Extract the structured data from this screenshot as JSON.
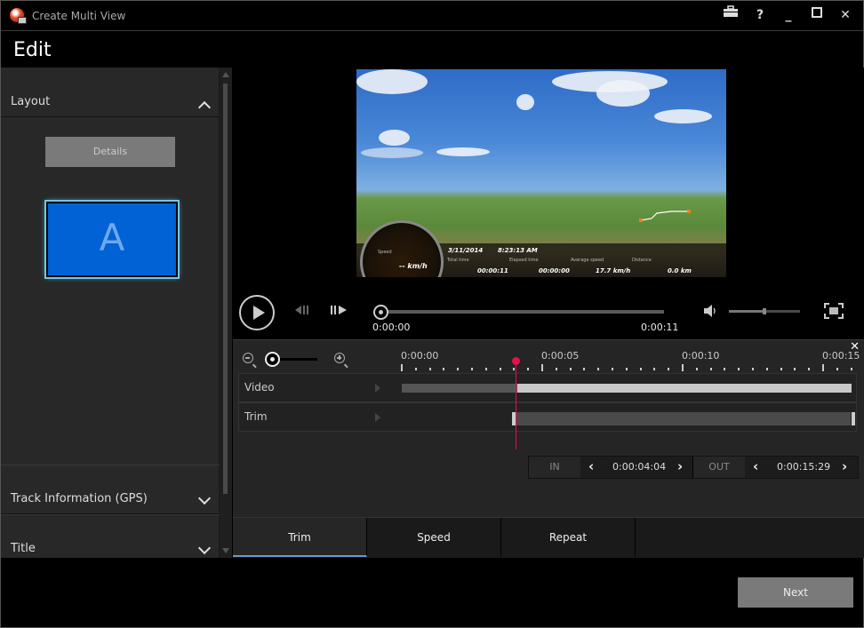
{
  "window": {
    "title": "Create Multi View",
    "buttons": {
      "toolbox": "🧰",
      "help": "?",
      "minimize": "_",
      "maximize": "☐",
      "close": "✕"
    }
  },
  "header": {
    "title": "Edit"
  },
  "sidebar": {
    "sections": [
      {
        "label": "Layout",
        "expanded": true
      },
      {
        "label": "Track Information (GPS)",
        "expanded": false
      },
      {
        "label": "Title",
        "expanded": false
      }
    ],
    "details_label": "Details",
    "layout_option": "A",
    "accent": "#0062d4"
  },
  "preview": {
    "overlay": {
      "date": "3/11/2014",
      "time": "8:23:13 AM",
      "speed_label": "Speed",
      "speed_value": "-- km/h",
      "total_time_label": "Total time",
      "total_time": "00:00:11",
      "elapsed_time_label": "Elapsed time",
      "elapsed_time": "00:00:00",
      "avg_speed_label": "Average speed",
      "avg_speed": "17.7 km/h",
      "distance_label": "Distance",
      "distance": "0.0 km"
    }
  },
  "player": {
    "current_time": "0:00:00",
    "duration": "0:00:11",
    "progress": 0,
    "volume": 0.5
  },
  "timeline": {
    "close": "✕",
    "ruler": [
      "0:00:00",
      "0:00:05",
      "0:00:10",
      "0:00:15"
    ],
    "tracks": [
      {
        "name": "Video"
      },
      {
        "name": "Trim"
      }
    ],
    "playhead_time": "0:00:04:04",
    "in_label": "IN",
    "in_value": "0:00:04:04",
    "out_label": "OUT",
    "out_value": "0:00:15:29",
    "prev": "‹",
    "next": "›",
    "playhead_color": "#e8104a"
  },
  "tabs": [
    {
      "label": "Trim",
      "active": true
    },
    {
      "label": "Speed",
      "active": false
    },
    {
      "label": "Repeat",
      "active": false
    }
  ],
  "footer": {
    "next_label": "Next"
  }
}
